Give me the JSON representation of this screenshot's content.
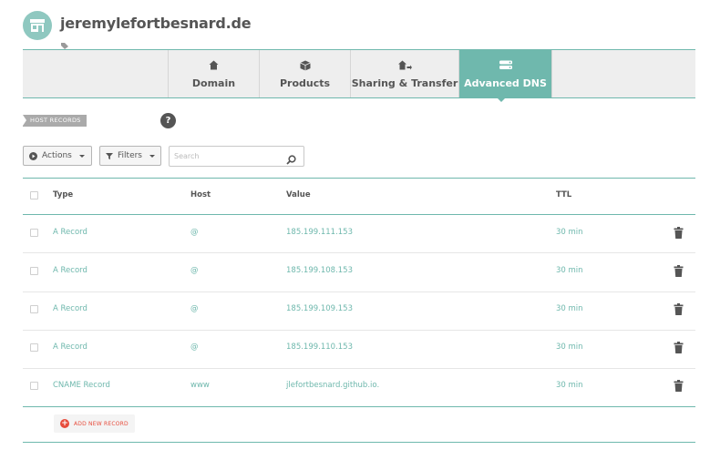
{
  "header": {
    "domain": "jeremylefortbesnard.de",
    "avatar_icon": "store-icon",
    "sub_icon": "tag-icon"
  },
  "tabs": [
    {
      "label": "Domain",
      "icon": "home-icon",
      "active": false
    },
    {
      "label": "Products",
      "icon": "box-icon",
      "active": false
    },
    {
      "label": "Sharing & Transfer",
      "icon": "transfer-icon",
      "active": false
    },
    {
      "label": "Advanced DNS",
      "icon": "dns-icon",
      "active": true
    }
  ],
  "section": {
    "label": "HOST RECORDS",
    "help": "?"
  },
  "toolbar": {
    "actions_label": "Actions",
    "filters_label": "Filters",
    "search_placeholder": "Search"
  },
  "table": {
    "columns": [
      "Type",
      "Host",
      "Value",
      "TTL"
    ],
    "rows": [
      {
        "type": "A Record",
        "host": "@",
        "value": "185.199.111.153",
        "ttl": "30 min"
      },
      {
        "type": "A Record",
        "host": "@",
        "value": "185.199.108.153",
        "ttl": "30 min"
      },
      {
        "type": "A Record",
        "host": "@",
        "value": "185.199.109.153",
        "ttl": "30 min"
      },
      {
        "type": "A Record",
        "host": "@",
        "value": "185.199.110.153",
        "ttl": "30 min"
      },
      {
        "type": "CNAME Record",
        "host": "www",
        "value": "jlefortbesnard.github.io.",
        "ttl": "30 min"
      }
    ],
    "add_label": "ADD NEW RECORD"
  },
  "colors": {
    "accent": "#6fb8ad",
    "danger": "#e74c3c"
  }
}
